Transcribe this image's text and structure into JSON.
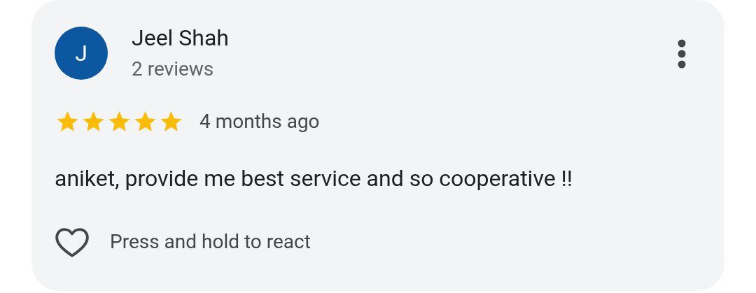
{
  "review": {
    "avatar_letter": "J",
    "name": "Jeel Shah",
    "reviews": "2 reviews",
    "stars": 5,
    "time": "4 months ago",
    "text": "aniket, provide me best service and so cooperative !!",
    "react_hint": "Press and hold to react",
    "liked": false
  }
}
